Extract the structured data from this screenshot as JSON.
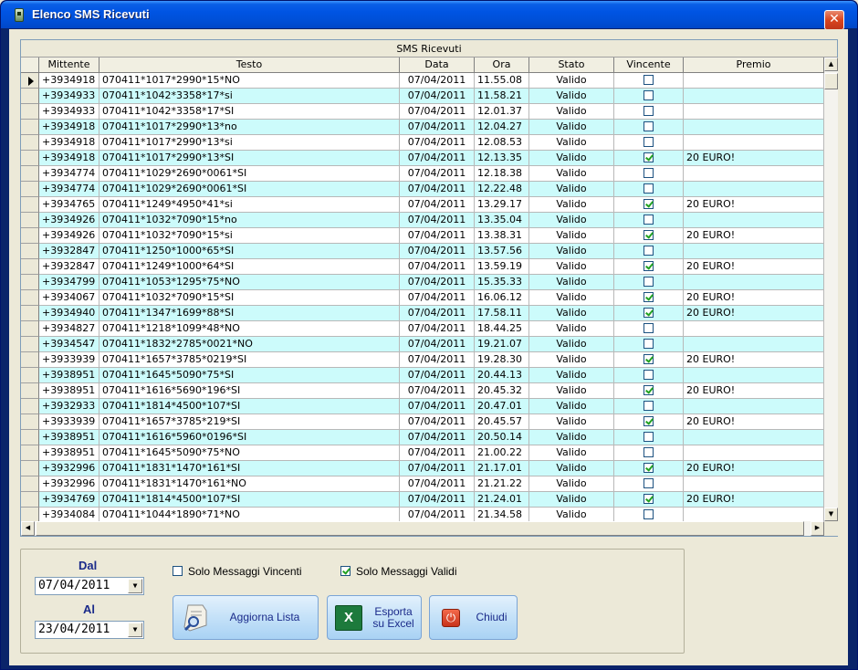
{
  "window": {
    "title": "Elenco SMS Ricevuti",
    "close_glyph": "✕"
  },
  "grid": {
    "group_header": "SMS Ricevuti",
    "columns": [
      "Mittente",
      "Testo",
      "Data",
      "Ora",
      "Stato",
      "Vincente",
      "Premio"
    ],
    "rows": [
      {
        "mittente": "+3934918",
        "testo": "070411*1017*2990*15*NO",
        "data": "07/04/2011",
        "ora": "11.55.08",
        "stato": "Valido",
        "vincente": false,
        "premio": ""
      },
      {
        "mittente": "+3934933",
        "testo": "070411*1042*3358*17*si",
        "data": "07/04/2011",
        "ora": "11.58.21",
        "stato": "Valido",
        "vincente": false,
        "premio": ""
      },
      {
        "mittente": "+3934933",
        "testo": "070411*1042*3358*17*SI",
        "data": "07/04/2011",
        "ora": "12.01.37",
        "stato": "Valido",
        "vincente": false,
        "premio": ""
      },
      {
        "mittente": "+3934918",
        "testo": "070411*1017*2990*13*no",
        "data": "07/04/2011",
        "ora": "12.04.27",
        "stato": "Valido",
        "vincente": false,
        "premio": ""
      },
      {
        "mittente": "+3934918",
        "testo": "070411*1017*2990*13*si",
        "data": "07/04/2011",
        "ora": "12.08.53",
        "stato": "Valido",
        "vincente": false,
        "premio": ""
      },
      {
        "mittente": "+3934918",
        "testo": "070411*1017*2990*13*SI",
        "data": "07/04/2011",
        "ora": "12.13.35",
        "stato": "Valido",
        "vincente": true,
        "premio": "20 EURO!"
      },
      {
        "mittente": "+3934774",
        "testo": "070411*1029*2690*0061*SI",
        "data": "07/04/2011",
        "ora": "12.18.38",
        "stato": "Valido",
        "vincente": false,
        "premio": ""
      },
      {
        "mittente": "+3934774",
        "testo": "070411*1029*2690*0061*SI",
        "data": "07/04/2011",
        "ora": "12.22.48",
        "stato": "Valido",
        "vincente": false,
        "premio": ""
      },
      {
        "mittente": "+3934765",
        "testo": "070411*1249*4950*41*si",
        "data": "07/04/2011",
        "ora": "13.29.17",
        "stato": "Valido",
        "vincente": true,
        "premio": "20 EURO!"
      },
      {
        "mittente": "+3934926",
        "testo": "070411*1032*7090*15*no",
        "data": "07/04/2011",
        "ora": "13.35.04",
        "stato": "Valido",
        "vincente": false,
        "premio": ""
      },
      {
        "mittente": "+3934926",
        "testo": "070411*1032*7090*15*si",
        "data": "07/04/2011",
        "ora": "13.38.31",
        "stato": "Valido",
        "vincente": true,
        "premio": "20 EURO!"
      },
      {
        "mittente": "+3932847",
        "testo": "070411*1250*1000*65*SI",
        "data": "07/04/2011",
        "ora": "13.57.56",
        "stato": "Valido",
        "vincente": false,
        "premio": ""
      },
      {
        "mittente": "+3932847",
        "testo": "070411*1249*1000*64*SI",
        "data": "07/04/2011",
        "ora": "13.59.19",
        "stato": "Valido",
        "vincente": true,
        "premio": "20 EURO!"
      },
      {
        "mittente": "+3934799",
        "testo": "070411*1053*1295*75*NO",
        "data": "07/04/2011",
        "ora": "15.35.33",
        "stato": "Valido",
        "vincente": false,
        "premio": ""
      },
      {
        "mittente": "+3934067",
        "testo": "070411*1032*7090*15*SI",
        "data": "07/04/2011",
        "ora": "16.06.12",
        "stato": "Valido",
        "vincente": true,
        "premio": "20 EURO!"
      },
      {
        "mittente": "+3934940",
        "testo": "070411*1347*1699*88*SI",
        "data": "07/04/2011",
        "ora": "17.58.11",
        "stato": "Valido",
        "vincente": true,
        "premio": "20 EURO!"
      },
      {
        "mittente": "+3934827",
        "testo": "070411*1218*1099*48*NO",
        "data": "07/04/2011",
        "ora": "18.44.25",
        "stato": "Valido",
        "vincente": false,
        "premio": ""
      },
      {
        "mittente": "+3934547",
        "testo": "070411*1832*2785*0021*NO",
        "data": "07/04/2011",
        "ora": "19.21.07",
        "stato": "Valido",
        "vincente": false,
        "premio": ""
      },
      {
        "mittente": "+3933939",
        "testo": "070411*1657*3785*0219*SI",
        "data": "07/04/2011",
        "ora": "19.28.30",
        "stato": "Valido",
        "vincente": true,
        "premio": "20 EURO!"
      },
      {
        "mittente": "+3938951",
        "testo": "070411*1645*5090*75*SI",
        "data": "07/04/2011",
        "ora": "20.44.13",
        "stato": "Valido",
        "vincente": false,
        "premio": ""
      },
      {
        "mittente": "+3938951",
        "testo": "070411*1616*5690*196*SI",
        "data": "07/04/2011",
        "ora": "20.45.32",
        "stato": "Valido",
        "vincente": true,
        "premio": "20 EURO!"
      },
      {
        "mittente": "+3932933",
        "testo": "070411*1814*4500*107*SI",
        "data": "07/04/2011",
        "ora": "20.47.01",
        "stato": "Valido",
        "vincente": false,
        "premio": ""
      },
      {
        "mittente": "+3933939",
        "testo": "070411*1657*3785*219*SI",
        "data": "07/04/2011",
        "ora": "20.45.57",
        "stato": "Valido",
        "vincente": true,
        "premio": "20 EURO!"
      },
      {
        "mittente": "+3938951",
        "testo": "070411*1616*5960*0196*SI",
        "data": "07/04/2011",
        "ora": "20.50.14",
        "stato": "Valido",
        "vincente": false,
        "premio": ""
      },
      {
        "mittente": "+3938951",
        "testo": "070411*1645*5090*75*NO",
        "data": "07/04/2011",
        "ora": "21.00.22",
        "stato": "Valido",
        "vincente": false,
        "premio": ""
      },
      {
        "mittente": "+3932996",
        "testo": "070411*1831*1470*161*SI",
        "data": "07/04/2011",
        "ora": "21.17.01",
        "stato": "Valido",
        "vincente": true,
        "premio": "20 EURO!"
      },
      {
        "mittente": "+3932996",
        "testo": "070411*1831*1470*161*NO",
        "data": "07/04/2011",
        "ora": "21.21.22",
        "stato": "Valido",
        "vincente": false,
        "premio": ""
      },
      {
        "mittente": "+3934769",
        "testo": "070411*1814*4500*107*SI",
        "data": "07/04/2011",
        "ora": "21.24.01",
        "stato": "Valido",
        "vincente": true,
        "premio": "20 EURO!"
      },
      {
        "mittente": "+3934084",
        "testo": "070411*1044*1890*71*NO",
        "data": "07/04/2011",
        "ora": "21.34.58",
        "stato": "Valido",
        "vincente": false,
        "premio": ""
      }
    ]
  },
  "filters": {
    "dal_label": "Dal",
    "dal_value": "07/04/2011",
    "al_label": "Al",
    "al_value": "23/04/2011",
    "solo_vincenti_label": "Solo Messaggi Vincenti",
    "solo_vincenti_checked": false,
    "solo_validi_label": "Solo Messaggi Validi",
    "solo_validi_checked": true
  },
  "buttons": {
    "aggiorna": "Aggiorna Lista",
    "esporta_line1": "Esporta",
    "esporta_line2": "su Excel",
    "chiudi": "Chiudi"
  },
  "colors": {
    "row_even": "#ffffff",
    "row_odd": "#ccfbfb",
    "accent": "#0054e3"
  }
}
